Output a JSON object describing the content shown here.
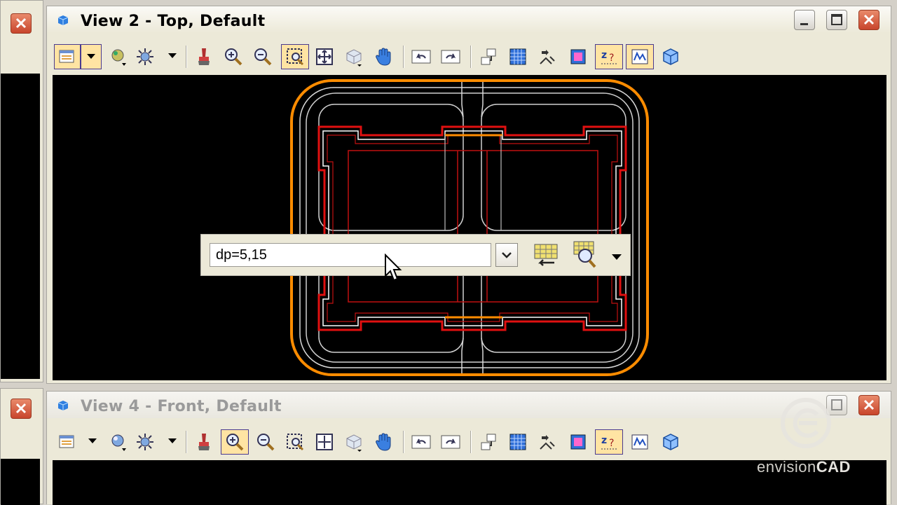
{
  "view2": {
    "title": "View 2 - Top, Default"
  },
  "view4": {
    "title": "View 4 - Front, Default"
  },
  "keyin": {
    "value": "dp=5,15"
  },
  "watermark": {
    "brand_a": "envision",
    "brand_b": "CAD"
  },
  "icons": {
    "view_icon": "cube-view-icon",
    "view_attributes": "view-attributes-icon",
    "display_style": "display-style-icon",
    "lighting": "lighting-sun-icon",
    "update": "brush-update-icon",
    "zoom_in": "zoom-in-icon",
    "zoom_out": "zoom-out-icon",
    "window_area": "window-area-icon",
    "fit_view": "fit-view-icon",
    "rotate": "rotate-view-icon",
    "pan": "pan-hand-icon",
    "view_previous": "view-previous-icon",
    "view_next": "view-next-icon",
    "copy_view": "copy-view-icon",
    "toggle_grid": "grid-icon",
    "camera": "camera-icon",
    "clip_volume": "clip-volume-icon",
    "depth": "depth-icon",
    "clip_mask": "clip-mask-icon",
    "cube_3d": "cube-3d-icon"
  },
  "colors": {
    "orange": "#ff8c00",
    "red": "#e01010",
    "highlight": "#ffe4a3",
    "canvas": "#000000"
  }
}
